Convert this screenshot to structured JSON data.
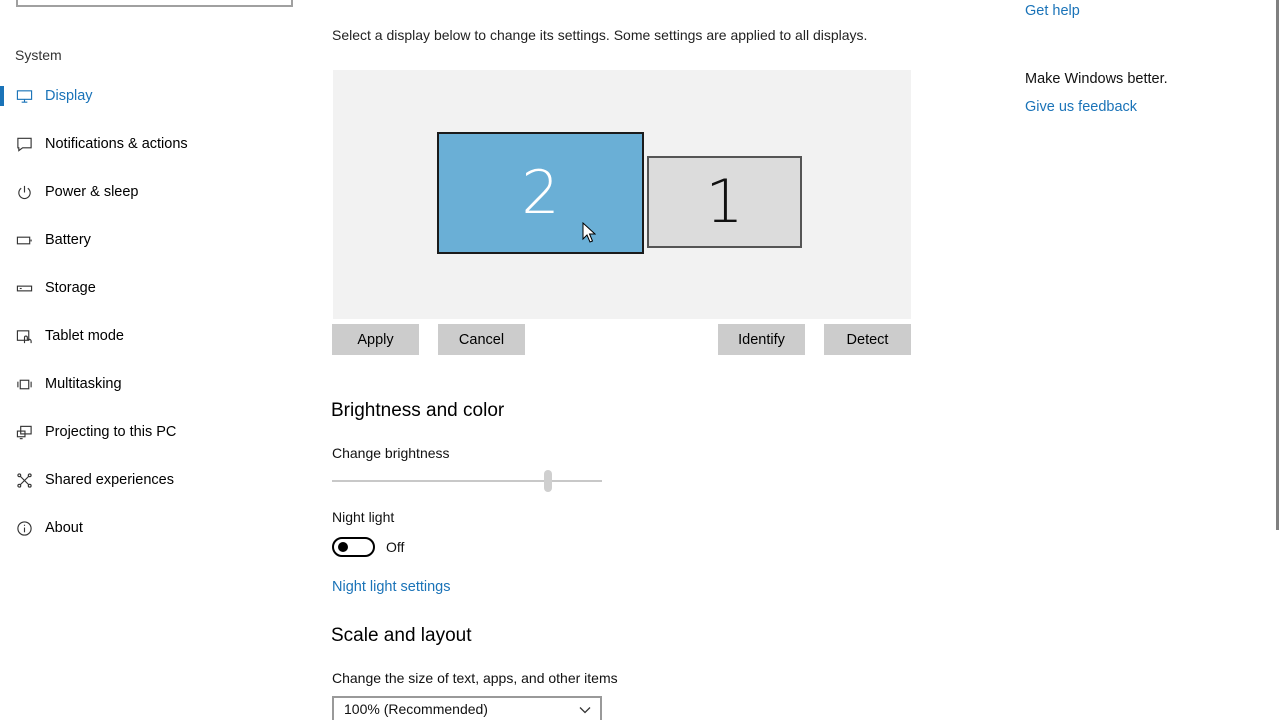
{
  "sidebar": {
    "section_label": "System",
    "items": [
      {
        "label": "Display",
        "icon": "monitor-icon",
        "active": true
      },
      {
        "label": "Notifications & actions",
        "icon": "message-icon"
      },
      {
        "label": "Power & sleep",
        "icon": "power-icon"
      },
      {
        "label": "Battery",
        "icon": "battery-icon"
      },
      {
        "label": "Storage",
        "icon": "storage-icon"
      },
      {
        "label": "Tablet mode",
        "icon": "tablet-icon"
      },
      {
        "label": "Multitasking",
        "icon": "multitasking-icon"
      },
      {
        "label": "Projecting to this PC",
        "icon": "projecting-icon"
      },
      {
        "label": "Shared experiences",
        "icon": "shared-icon"
      },
      {
        "label": "About",
        "icon": "info-icon"
      }
    ]
  },
  "main": {
    "intro": "Select a display below to change its settings. Some settings are applied to all displays.",
    "displays": [
      {
        "number": "2",
        "selected": true
      },
      {
        "number": "1",
        "selected": false
      }
    ],
    "buttons": {
      "apply": "Apply",
      "cancel": "Cancel",
      "identify": "Identify",
      "detect": "Detect"
    },
    "brightness": {
      "section_title": "Brightness and color",
      "label": "Change brightness",
      "value_percent": 80
    },
    "night_light": {
      "label": "Night light",
      "state": "Off",
      "settings_link": "Night light settings"
    },
    "scale": {
      "section_title": "Scale and layout",
      "label": "Change the size of text, apps, and other items",
      "selected": "100% (Recommended)"
    }
  },
  "right": {
    "get_help": "Get help",
    "make_better": "Make Windows better.",
    "feedback": "Give us feedback"
  },
  "colors": {
    "accent": "#1a73b8",
    "selected_display": "#6aafd6",
    "button_bg": "#cccccc"
  }
}
